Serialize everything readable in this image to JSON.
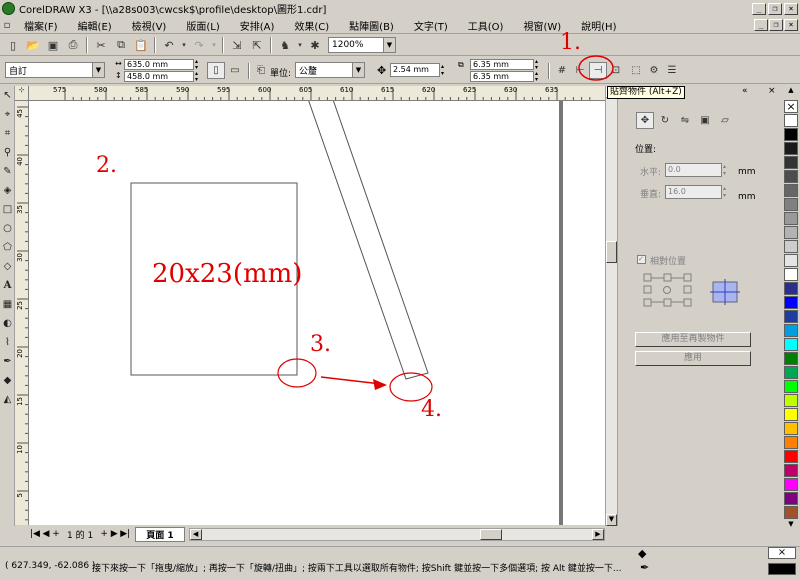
{
  "app": {
    "title": "CorelDRAW X3 - [\\\\a28s003\\cwcsk$\\profile\\desktop\\圖形1.cdr]"
  },
  "menu": [
    "檔案(F)",
    "編輯(E)",
    "檢視(V)",
    "版面(L)",
    "安排(A)",
    "效果(C)",
    "點陣圖(B)",
    "文字(T)",
    "工具(O)",
    "視窗(W)",
    "說明(H)"
  ],
  "toolbar1": {
    "zoom": "1200%"
  },
  "toolbar2": {
    "preset": "自訂",
    "width": "635.0 mm",
    "height": "458.0 mm",
    "units_label": "單位:",
    "units": "公釐",
    "nudge": "2.54 mm",
    "dup_x": "6.35 mm",
    "dup_y": "6.35 mm"
  },
  "tooltip": "貼齊物件 (Alt+Z)",
  "ruler_h": [
    "575",
    "580",
    "585",
    "590",
    "595",
    "600",
    "605",
    "610",
    "615",
    "620",
    "625",
    "630",
    "635"
  ],
  "ruler_v": [
    "45",
    "40",
    "35",
    "30",
    "25",
    "20",
    "15",
    "10",
    "5"
  ],
  "canvas": {
    "size_label": "20x23(mm)"
  },
  "annotations": [
    "1.",
    "2.",
    "3.",
    "4."
  ],
  "docker": {
    "position_label": "位置:",
    "horizontal_label": "水平:",
    "horizontal_value": "0.0",
    "vertical_label": "垂直:",
    "vertical_value": "16.0",
    "unit": "mm",
    "relative_label": "相對位置",
    "apply_dup": "應用至再製物件",
    "apply": "應用"
  },
  "pages": {
    "count": "1 的 1",
    "tab": "頁面 1"
  },
  "status": {
    "coords": "( 627.349, -62.086 )",
    "hint": "接下來按一下「拖曳/縮放」; 再按一下「旋轉/扭曲」; 按兩下工具以選取所有物件; 按Shift 鍵並按一下多個選項; 按 Alt 鍵並按一下..."
  },
  "palette_colors": [
    "#ffffff",
    "#000000",
    "#1a1a1a",
    "#333333",
    "#4d4d4d",
    "#666666",
    "#808080",
    "#999999",
    "#b3b3b3",
    "#cccccc",
    "#e5e5e5",
    "#ffffff",
    "#2b2e8c",
    "#0000ff",
    "#1e3d9e",
    "#00a0e0",
    "#00ffff",
    "#008000",
    "#00a651",
    "#00ff00",
    "#c0ff00",
    "#ffff00",
    "#ffc000",
    "#ff8000",
    "#ff0000",
    "#c0006a",
    "#ff00ff",
    "#800080",
    "#a0522d"
  ]
}
